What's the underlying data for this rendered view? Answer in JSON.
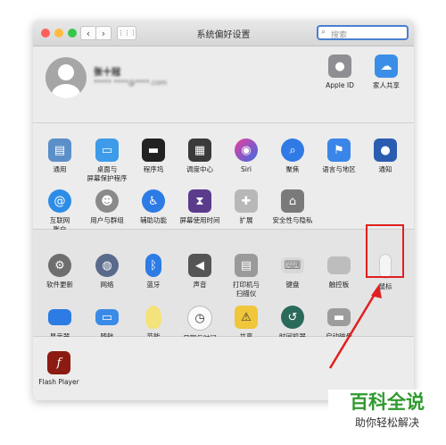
{
  "window": {
    "title": "系统偏好设置",
    "search_placeholder": "搜索"
  },
  "nav": {
    "back": "‹",
    "forward": "›",
    "grid": "⋮⋮⋮"
  },
  "user": {
    "name": "张十冠",
    "email": "***** ****@****.com"
  },
  "top_right": [
    {
      "label": "Apple ID",
      "icon": "apple-icon"
    },
    {
      "label": "家人共享",
      "icon": "family-icon"
    }
  ],
  "row1": [
    "通用",
    "桌面与\n屏幕保护程序",
    "程序坞",
    "调度中心",
    "Siri",
    "聚焦",
    "语言与地区",
    "通知"
  ],
  "row2": [
    "互联网\n账户",
    "用户与群组",
    "辅助功能",
    "屏幕使用时间",
    "扩展",
    "安全性与隐私"
  ],
  "row3": [
    "软件更新",
    "网络",
    "蓝牙",
    "声音",
    "打印机与\n扫描仪",
    "键盘",
    "触控板",
    "鼠标"
  ],
  "row4": [
    "显示器",
    "随航",
    "节能",
    "日期与时间",
    "共享",
    "时间机器",
    "启动磁盘"
  ],
  "other": [
    "Flash Player"
  ],
  "colors": {
    "accent": "#4a7fd0",
    "highlight": "#e02020",
    "watermark": "#2f9a2f"
  },
  "watermark": {
    "line1": "百科全说",
    "line2": "助你轻松解决"
  }
}
